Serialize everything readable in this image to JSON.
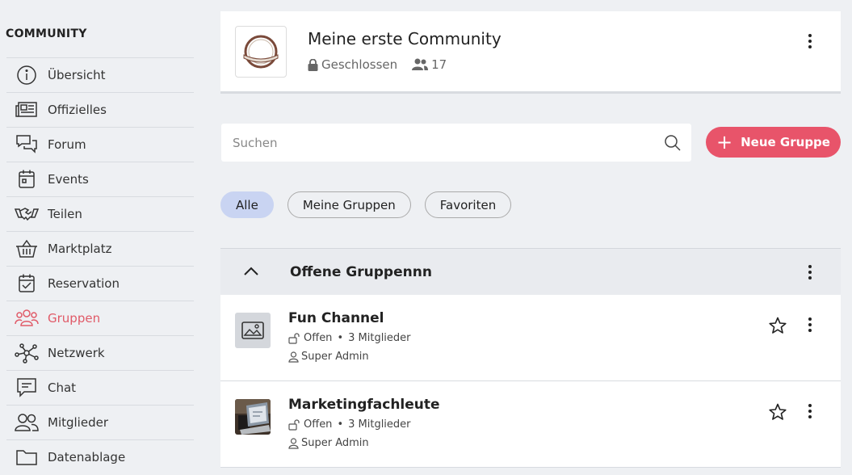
{
  "sidebar": {
    "heading": "COMMUNITY",
    "items": [
      {
        "label": "Übersicht",
        "icon": "info-icon"
      },
      {
        "label": "Offizielles",
        "icon": "newspaper-icon"
      },
      {
        "label": "Forum",
        "icon": "chat-bubbles-icon"
      },
      {
        "label": "Events",
        "icon": "calendar-icon"
      },
      {
        "label": "Teilen",
        "icon": "handshake-icon"
      },
      {
        "label": "Marktplatz",
        "icon": "basket-icon"
      },
      {
        "label": "Reservation",
        "icon": "calendar-check-icon"
      },
      {
        "label": "Gruppen",
        "icon": "groups-icon",
        "active": true
      },
      {
        "label": "Netzwerk",
        "icon": "network-icon"
      },
      {
        "label": "Chat",
        "icon": "chat-icon"
      },
      {
        "label": "Mitglieder",
        "icon": "members-icon"
      },
      {
        "label": "Datenablage",
        "icon": "folder-icon"
      }
    ]
  },
  "header": {
    "community_name": "Meine erste Community",
    "visibility": "Geschlossen",
    "member_count": "17"
  },
  "search": {
    "placeholder": "Suchen"
  },
  "new_group_label": "Neue Gruppe",
  "filters": [
    {
      "label": "Alle",
      "active": true
    },
    {
      "label": "Meine Gruppen"
    },
    {
      "label": "Favoriten"
    }
  ],
  "section": {
    "title": "Offene Gruppennn"
  },
  "groups": [
    {
      "name": "Fun Channel",
      "status": "Offen",
      "members": "3 Mitglieder",
      "owner": "Super Admin"
    },
    {
      "name": "Marketingfachleute",
      "status": "Offen",
      "members": "3 Mitglieder",
      "owner": "Super Admin"
    }
  ],
  "colors": {
    "accent": "#e8546a",
    "active_nav": "#e05a68",
    "active_chip": "#c9d4f2",
    "background": "#eef0f3"
  }
}
